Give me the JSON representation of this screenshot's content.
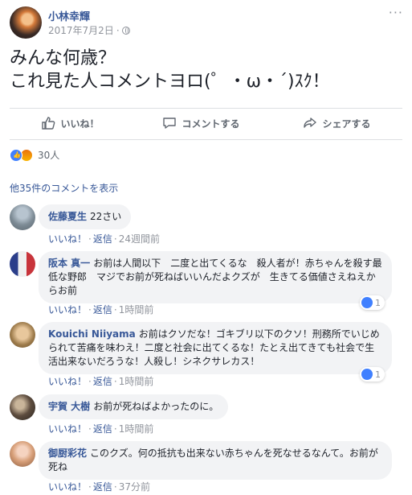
{
  "post": {
    "author": "小林幸輝",
    "date": "2017年7月2日",
    "separator": "·",
    "more_icon": "more-dots-icon",
    "text_line1": "みんな何歳？",
    "text_line2": "これ見た人コメントヨロ(゜・ω・´)ｽｸ！"
  },
  "actions": {
    "like": "いいね！",
    "comment": "コメントする",
    "share": "シェアする"
  },
  "reactions": {
    "count": "30人",
    "types": [
      "like",
      "angry"
    ]
  },
  "more_comments": "他35件のコメントを表示",
  "link_like": "いいね！",
  "link_reply": "返信",
  "comments": [
    {
      "name": "佐藤夏生",
      "text": "22さい",
      "time": "24週間前",
      "likes": ""
    },
    {
      "name": "阪本 真一",
      "text": "お前は人間以下　二度と出てくるな　殺人者が！赤ちゃんを殺す最低な野郎　マジでお前が死ねばいいんだよクズが　生きてる価値さえねえからお前",
      "time": "1時間前",
      "likes": "1"
    },
    {
      "name": "Kouichi Niiyama",
      "text": "お前はクソだな！ゴキブリ以下のクソ！刑務所でいじめられて苦痛を味わえ！二度と社会に出てくるな！たとえ出てきても社会で生活出来ないだろうな！人殺し！シネクサレカス！",
      "time": "1時間前",
      "likes": "1"
    },
    {
      "name": "宇賀 大樹",
      "text": "お前が死ねばよかったのに。",
      "time": "1時間前",
      "likes": ""
    },
    {
      "name": "御厨彩花",
      "text": "このクズ。何の抵抗も出来ない赤ちゃんを死なせるなんて。お前が死ね",
      "time": "37分前",
      "likes": ""
    }
  ]
}
